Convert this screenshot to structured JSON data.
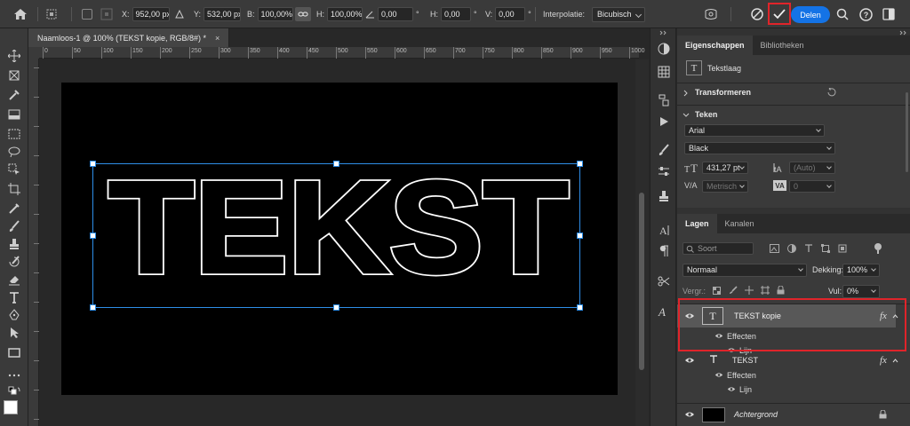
{
  "options_bar": {
    "x_label": "X:",
    "x_value": "952,00 px",
    "y_label": "Y:",
    "y_value": "532,00 px",
    "w_label": "B:",
    "w_value": "100,00%",
    "h_label": "H:",
    "h_value": "100,00%",
    "angle_value": "0,00",
    "hskew_label": "H:",
    "hskew_value": "0,00",
    "vskew_label": "V:",
    "vskew_value": "0,00",
    "degree_symbol": "°",
    "interpolation_label": "Interpolatie:",
    "interpolation_value": "Bicubisch",
    "share_label": "Delen",
    "accent_color": "#1473e6",
    "highlight_color": "#e0242a"
  },
  "document": {
    "tab_title": "Naamloos-1 @ 100% (TEKST kopie, RGB/8#) *",
    "close_symbol": "×",
    "canvas_text": "TEKST",
    "ruler_labels": [
      "0",
      "50",
      "100",
      "150",
      "200",
      "250",
      "300",
      "350",
      "400",
      "450",
      "500",
      "550",
      "600",
      "650",
      "700",
      "750",
      "800",
      "850",
      "900",
      "950",
      "1000",
      "1050",
      "1100",
      "1150",
      "1200",
      "1250",
      "1300",
      "1350",
      "1400",
      "1450",
      "1500",
      "1550",
      "1600",
      "1650",
      "1700",
      "1750",
      "1800",
      "1850"
    ]
  },
  "properties_panel": {
    "tabs": [
      "Eigenschappen",
      "Bibliotheken"
    ],
    "layer_type": "Tekstlaag",
    "transform_label": "Transformeren",
    "type_label": "Teken",
    "font_family": "Arial",
    "font_style": "Black",
    "font_size": "431,27 pt",
    "leading": "(Auto)",
    "kerning": "Metrisch",
    "tracking": "0"
  },
  "layers_panel": {
    "tabs": [
      "Lagen",
      "Kanalen"
    ],
    "filter_placeholder": "Soort",
    "blend_mode": "Normaal",
    "opacity_label": "Dekking:",
    "opacity_value": "100%",
    "lock_label": "Vergr.:",
    "fill_label": "Vul:",
    "fill_value": "0%",
    "fx_label": "fx",
    "layers": [
      {
        "name": "TEKST kopie",
        "effects_label": "Effecten",
        "effect_name": "Lijn"
      },
      {
        "name": "TEKST",
        "effects_label": "Effecten",
        "effect_name": "Lijn"
      },
      {
        "name": "Achtergrond"
      }
    ]
  },
  "icons": [
    "home-icon",
    "move-icon",
    "checkmark-icon",
    "cancel-icon",
    "search-icon",
    "help-icon",
    "workspace-icon",
    "eye-icon",
    "lock-icon",
    "text-layer-icon",
    "fx-icon"
  ]
}
